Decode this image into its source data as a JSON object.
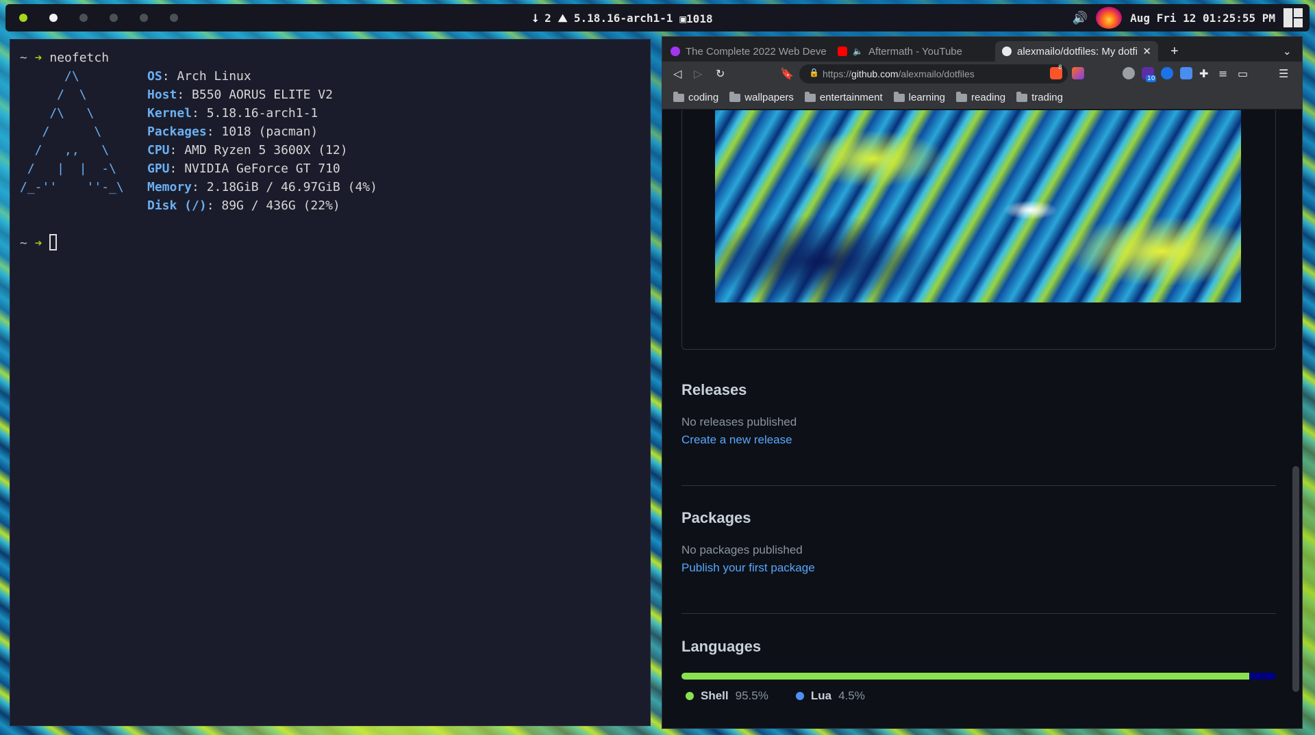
{
  "topbar": {
    "updates_count": "2",
    "kernel": "5.18.16-arch1-1",
    "packages_count": "1018",
    "datetime": "Aug Fri 12 01:25:55 PM",
    "icons": [
      "download-arrow-icon",
      "tux-icon",
      "package-icon",
      "volume-icon",
      "layout-icon"
    ]
  },
  "terminal": {
    "prompt_tilde": "~",
    "command": "neofetch",
    "ascii_art": [
      "      /\\",
      "     /  \\",
      "    /\\   \\",
      "   /      \\",
      "  /   ,,   \\",
      " /   |  |  -\\",
      "/_-''    ''-_\\"
    ],
    "info": [
      {
        "label": "OS",
        "value": ": Arch Linux"
      },
      {
        "label": "Host",
        "value": ": B550 AORUS ELITE V2"
      },
      {
        "label": "Kernel",
        "value": ": 5.18.16-arch1-1"
      },
      {
        "label": "Packages",
        "value": ": 1018 (pacman)"
      },
      {
        "label": "CPU",
        "value": ": AMD Ryzen 5 3600X (12)"
      },
      {
        "label": "GPU",
        "value": ": NVIDIA GeForce GT 710"
      },
      {
        "label": "Memory",
        "value": ": 2.18GiB / 46.97GiB (4%)"
      },
      {
        "label": "Disk (/)",
        "value": ": 89G / 436G (22%)"
      }
    ]
  },
  "browser": {
    "tabs": [
      {
        "title": "The Complete 2022 Web Deve"
      },
      {
        "title": "Aftermath - YouTube"
      },
      {
        "title": "alexmailo/dotfiles: My dotfi"
      }
    ],
    "url_prefix": "https://",
    "url_domain": "github.com",
    "url_path": "/alexmailo/dotfiles",
    "bookmarks": [
      "coding",
      "wallpapers",
      "entertainment",
      "learning",
      "reading",
      "trading"
    ],
    "brave_badge": "8",
    "ext_badge": "10"
  },
  "github": {
    "releases": {
      "title": "Releases",
      "empty": "No releases published",
      "link": "Create a new release"
    },
    "packages": {
      "title": "Packages",
      "empty": "No packages published",
      "link": "Publish your first package"
    },
    "languages": {
      "title": "Languages",
      "items": [
        {
          "name": "Shell",
          "percent": "95.5%",
          "value": 95.5,
          "color": "#89e051"
        },
        {
          "name": "Lua",
          "percent": "4.5%",
          "value": 4.5,
          "color": "#000080"
        }
      ]
    }
  },
  "colors": {
    "accent": "#a6d71c",
    "link": "#58a6ff",
    "terminal_label": "#6ab0f3"
  }
}
